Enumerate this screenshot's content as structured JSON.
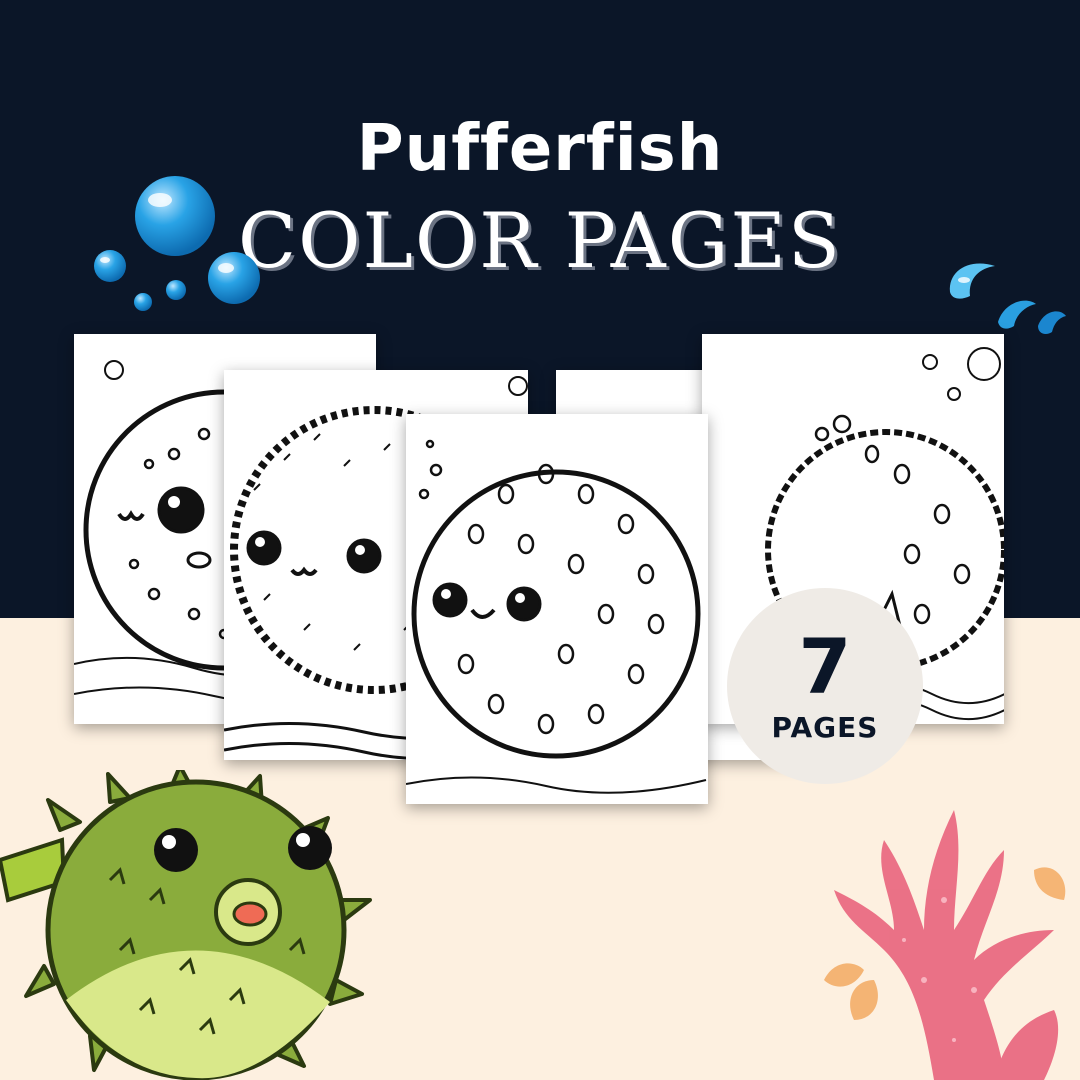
{
  "title": {
    "line1": "Pufferfish",
    "line2": "COLOR PAGES"
  },
  "badge": {
    "count": "7",
    "label": "PAGES"
  },
  "colors": {
    "navy": "#0b1628",
    "cream": "#fdf0e0",
    "badge": "#efebe6",
    "bubble": "#29a3e6",
    "puffer_green": "#8aac3c",
    "coral_pink": "#e8607a",
    "coral_orange": "#f2a65a"
  },
  "pages": [
    {
      "name": "coloring-page-1"
    },
    {
      "name": "coloring-page-2"
    },
    {
      "name": "coloring-page-3"
    },
    {
      "name": "coloring-page-4"
    },
    {
      "name": "coloring-page-5"
    }
  ],
  "icons": [
    "bubbles-icon",
    "water-splash-icon",
    "pufferfish-illustration",
    "coral-illustration"
  ]
}
